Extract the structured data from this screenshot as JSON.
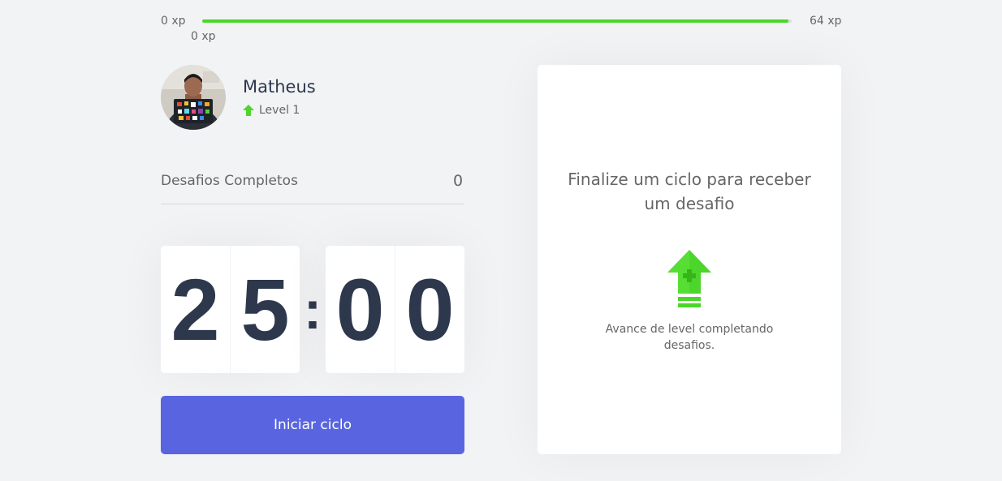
{
  "xp_bar": {
    "min_label": "0 xp",
    "current_label": "0 xp",
    "max_label": "64 xp",
    "progress_fraction": 0.995,
    "fill_color": "#4cd62b"
  },
  "profile": {
    "name": "Matheus",
    "level_label": "Level 1",
    "level_icon": "level-up-arrow-icon"
  },
  "challenges_completed": {
    "label": "Desafios Completos",
    "count": "0"
  },
  "countdown": {
    "minute_tens": "2",
    "minute_ones": "5",
    "separator": ":",
    "second_tens": "0",
    "second_ones": "0"
  },
  "start_button": {
    "label": "Iniciar ciclo",
    "color": "#5965e0"
  },
  "challenge_card": {
    "title": "Finalize um ciclo para receber um desafio",
    "icon": "level-up-icon",
    "hint": "Avance de level completando desafios."
  }
}
